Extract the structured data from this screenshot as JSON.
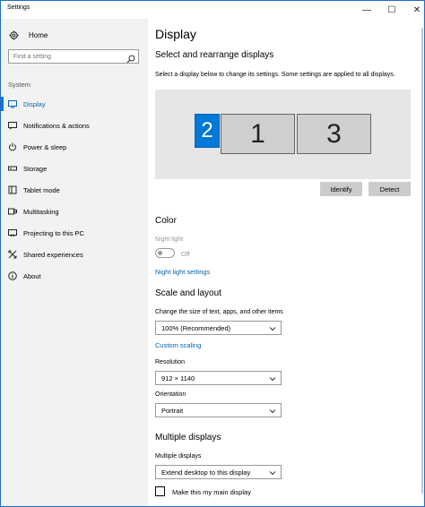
{
  "window": {
    "title": "Settings",
    "controls": {
      "minimize": "—",
      "maximize": "☐",
      "close": "✕"
    }
  },
  "sidebar": {
    "home": {
      "label": "Home",
      "icon": "gear-icon"
    },
    "search": {
      "placeholder": "Find a setting",
      "icon": "search-icon"
    },
    "section": "System",
    "items": [
      {
        "label": "Display",
        "icon": "monitor-icon",
        "active": true
      },
      {
        "label": "Notifications & actions",
        "icon": "notifications-icon"
      },
      {
        "label": "Power & sleep",
        "icon": "power-icon"
      },
      {
        "label": "Storage",
        "icon": "storage-icon"
      },
      {
        "label": "Tablet mode",
        "icon": "tablet-icon"
      },
      {
        "label": "Multitasking",
        "icon": "multitasking-icon"
      },
      {
        "label": "Projecting to this PC",
        "icon": "projecting-icon"
      },
      {
        "label": "Shared experiences",
        "icon": "shared-experiences-icon"
      },
      {
        "label": "About",
        "icon": "info-icon"
      }
    ]
  },
  "main": {
    "title": "Display",
    "arrange": {
      "heading": "Select and rearrange displays",
      "description": "Select a display below to change its settings. Some settings are applied to all displays.",
      "monitors": {
        "selected": "2",
        "second": "1",
        "third": "3"
      },
      "identify_label": "Identify",
      "detect_label": "Detect"
    },
    "color": {
      "heading": "Color",
      "night_light_label": "Night light",
      "night_light_state": "Off",
      "night_light_settings_link": "Night light settings"
    },
    "scale": {
      "heading": "Scale and layout",
      "size_label": "Change the size of text, apps, and other items",
      "size_value": "100% (Recommended)",
      "custom_scaling_link": "Custom scaling",
      "resolution_label": "Resolution",
      "resolution_value": "912 × 1140",
      "orientation_label": "Orientation",
      "orientation_value": "Portrait"
    },
    "multiple": {
      "heading": "Multiple displays",
      "label": "Multiple displays",
      "value": "Extend desktop to this display",
      "main_display_label": "Make this my main display"
    }
  },
  "colors": {
    "accent": "#0078d7",
    "link": "#0063b1",
    "sidebar_bg": "#f2f2f2",
    "display_area_bg": "#e6e6e6"
  }
}
